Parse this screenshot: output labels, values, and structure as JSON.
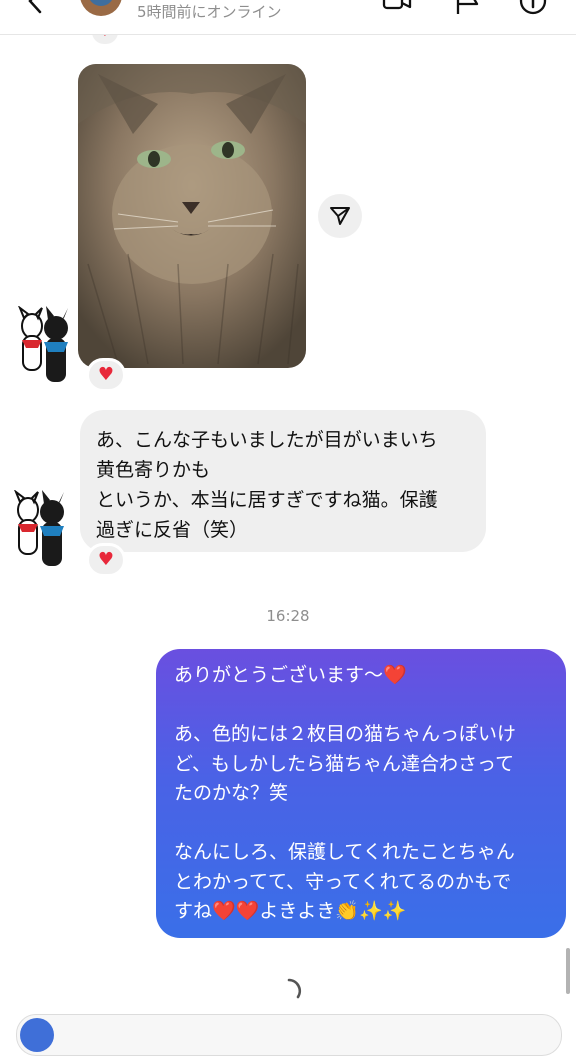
{
  "header": {
    "status": "5時間前にオンライン"
  },
  "messages": {
    "received_text_lines": [
      "あ、こんな子もいましたが目がいまいち",
      "黄色寄りかも",
      "というか、本当に居すぎですね猫。保護",
      "過ぎに反省（笑）"
    ],
    "timestamp": "16:28",
    "sent_paragraph_1": "ありがとうございます〜❤️",
    "sent_paragraph_2_lines": [
      "あ、色的には２枚目の猫ちゃんっぽいけ",
      "ど、もしかしたら猫ちゃん達合わさって",
      "たのかな？笑"
    ],
    "sent_paragraph_3_lines": [
      "なんにしろ、保護してくれたことちゃん",
      "とわかってて、守ってくれてるのかもで",
      "すね❤️❤️よきよき👏✨✨"
    ],
    "reaction_emoji": "❤️"
  },
  "icons": {
    "back": "chevron-left-icon",
    "video": "video-call-icon",
    "flag": "flag-icon",
    "info": "info-icon",
    "share": "send-icon",
    "spinner": "loading-spinner-icon"
  },
  "colors": {
    "sent_bubble_top": "#6a4fe0",
    "sent_bubble_bottom": "#3a6fe8",
    "received_bubble": "#efefef",
    "meta_text": "#8e8e8e"
  }
}
